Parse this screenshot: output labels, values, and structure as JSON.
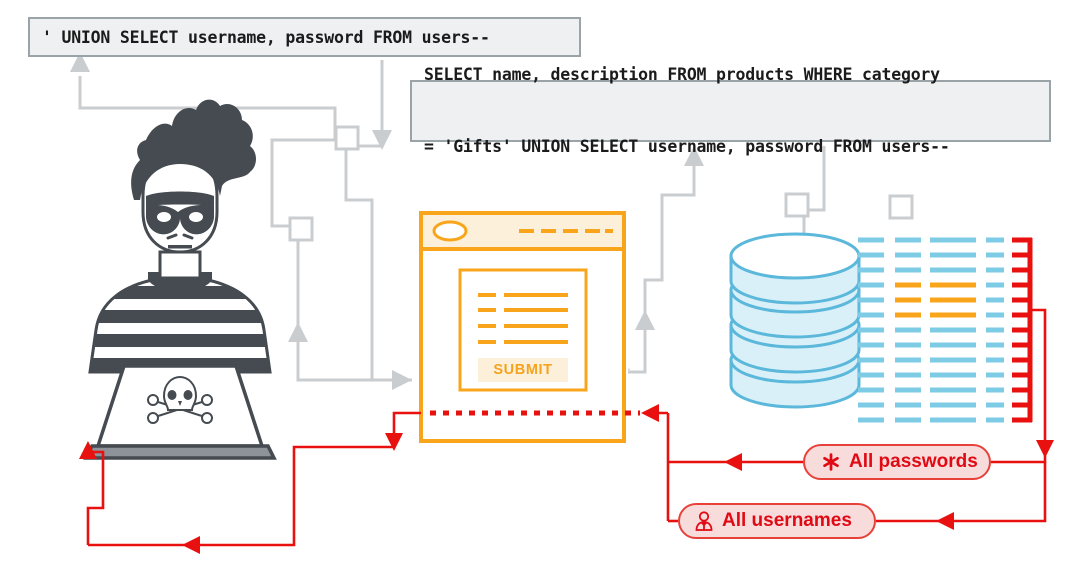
{
  "diagram": {
    "title": "SQL injection UNION attack flow",
    "colors": {
      "connector_gray": "#c9cdd0",
      "browser_orange": "#f9a51b",
      "database_blue": "#5bb8db",
      "attack_red": "#e8110f",
      "pill_fill": "#f8dcdc",
      "code_box_fill": "#eef0f2",
      "code_box_border": "#9aa3a8",
      "figure_dark": "#454b51"
    }
  },
  "code_boxes": {
    "injected_payload": "' UNION SELECT username, password FROM users--",
    "resulting_query_line1": "SELECT name, description FROM products WHERE category",
    "resulting_query_line2": "= 'Gifts' UNION SELECT username, password FROM users--"
  },
  "browser": {
    "submit_label": "SUBMIT",
    "form_rows": 4,
    "titlebar_dashes": 5
  },
  "database": {
    "disc_count": 4,
    "grid_columns": 5,
    "grid_rows": 13,
    "highlighted_columns": [
      2,
      3
    ]
  },
  "callouts": [
    {
      "id": "passwords",
      "icon": "asterisk-icon",
      "label": "All passwords"
    },
    {
      "id": "usernames",
      "icon": "user-icon",
      "label": "All usernames"
    }
  ],
  "actor": {
    "name": "hacker-figure",
    "laptop_emblem": "skull-and-crossbones-icon"
  }
}
